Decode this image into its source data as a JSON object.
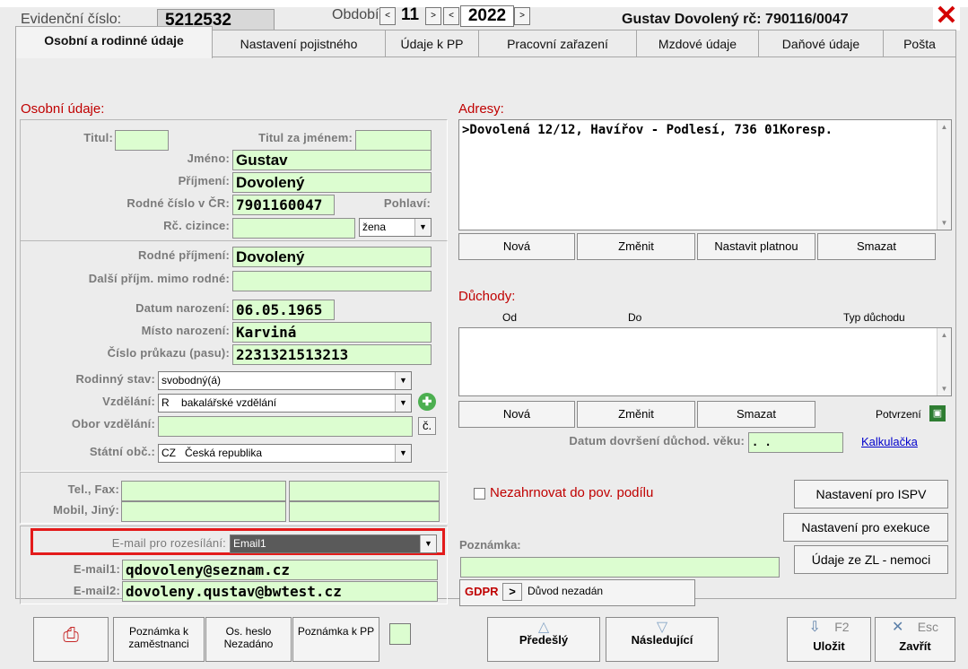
{
  "header": {
    "evid_label": "Evidenční číslo:",
    "evid_value": "5212532",
    "period_label": "Období:",
    "month": "11",
    "year": "2022",
    "person": "Gustav Dovolený rč: 790116/0047"
  },
  "tabs": [
    {
      "label": "Osobní a rodinné údaje"
    },
    {
      "label": "Nastavení pojistného"
    },
    {
      "label": "Údaje k PP"
    },
    {
      "label": "Pracovní zařazení"
    },
    {
      "label": "Mzdové údaje"
    },
    {
      "label": "Daňové údaje"
    },
    {
      "label": "Pošta"
    }
  ],
  "personal": {
    "section": "Osobní údaje:",
    "titul_label": "Titul:",
    "titul_za_label": "Titul za jménem:",
    "jmeno_label": "Jméno:",
    "jmeno": "Gustav",
    "prijmeni_label": "Příjmení:",
    "prijmeni": "Dovolený",
    "rc_label": "Rodné číslo v ČR:",
    "rc": "7901160047",
    "pohlavi_label": "Pohlaví:",
    "rc_cizince_label": "Rč. cizince:",
    "pohlavi": "žena",
    "rodne_prijmeni_label": "Rodné příjmení:",
    "rodne_prijmeni": "Dovolený",
    "dalsi_prijm_label": "Další příjm. mimo rodné:",
    "datum_nar_label": "Datum narození:",
    "datum_nar": "06.05.1965",
    "misto_nar_label": "Místo narození:",
    "misto_nar": "Karviná",
    "prukaz_label": "Číslo průkazu (pasu):",
    "prukaz": "2231321513213",
    "rod_stav_label": "Rodinný stav:",
    "rod_stav": "svobodný(á)",
    "vzdelani_label": "Vzdělání:",
    "vzdelani_code": "R",
    "vzdelani": "bakalářské vzdělání",
    "obor_label": "Obor vzdělání:",
    "obor_btn": "č.",
    "obcanstvi_label": "Státní obč.:",
    "obcanstvi_code": "CZ",
    "obcanstvi": "Česká republika",
    "tel_label": "Tel., Fax:",
    "mobil_label": "Mobil, Jiný:",
    "email_roz_label": "E-mail pro rozesílání:",
    "email_roz": "Email1",
    "email1_label": "E-mail1:",
    "email1": "qdovoleny@seznam.cz",
    "email2_label": "E-mail2:",
    "email2": "dovoleny.qustav@bwtest.cz"
  },
  "address": {
    "section": "Adresy:",
    "line": ">Dovolená 12/12, Havířov - Podlesí, 736 01Koresp.",
    "btn_new": "Nová",
    "btn_change": "Změnit",
    "btn_set": "Nastavit platnou",
    "btn_delete": "Smazat"
  },
  "pension": {
    "section": "Důchody:",
    "col_od": "Od",
    "col_do": "Do",
    "col_typ": "Typ důchodu",
    "btn_new": "Nová",
    "btn_change": "Změnit",
    "btn_delete": "Smazat",
    "potvrzeni": "Potvrzení",
    "datum_label": "Datum dovršení důchod. věku:",
    "datum_value": " .  .",
    "kalkulacka": "Kalkulačka"
  },
  "misc": {
    "nezahrnovat": "Nezahrnovat do pov. podílu",
    "btn_ispv": "Nastavení pro ISPV",
    "btn_exekuce": "Nastavení pro exekuce",
    "btn_zl": "Údaje ze ZL - nemoci",
    "poznamka_label": "Poznámka:",
    "gdpr_label": "GDPR",
    "gdpr_arrow": ">",
    "gdpr_value": "Důvod nezadán"
  },
  "bottom": {
    "pozn_zam": "Poznámka k zaměstnanci",
    "os_heslo_1": "Os. heslo",
    "os_heslo_2": "Nezadáno",
    "pozn_pp": "Poznámka k PP",
    "predesly": "Předešlý",
    "nasledujici": "Následující",
    "ulozit": "Uložit",
    "ulozit_key": "F2",
    "zavrit": "Zavřít",
    "zavrit_key": "Esc"
  },
  "colors": {
    "field_bg": "#dcfdd0",
    "section_red": "#c00000",
    "highlight_red": "#e31b1b",
    "close_red": "#d40000"
  }
}
